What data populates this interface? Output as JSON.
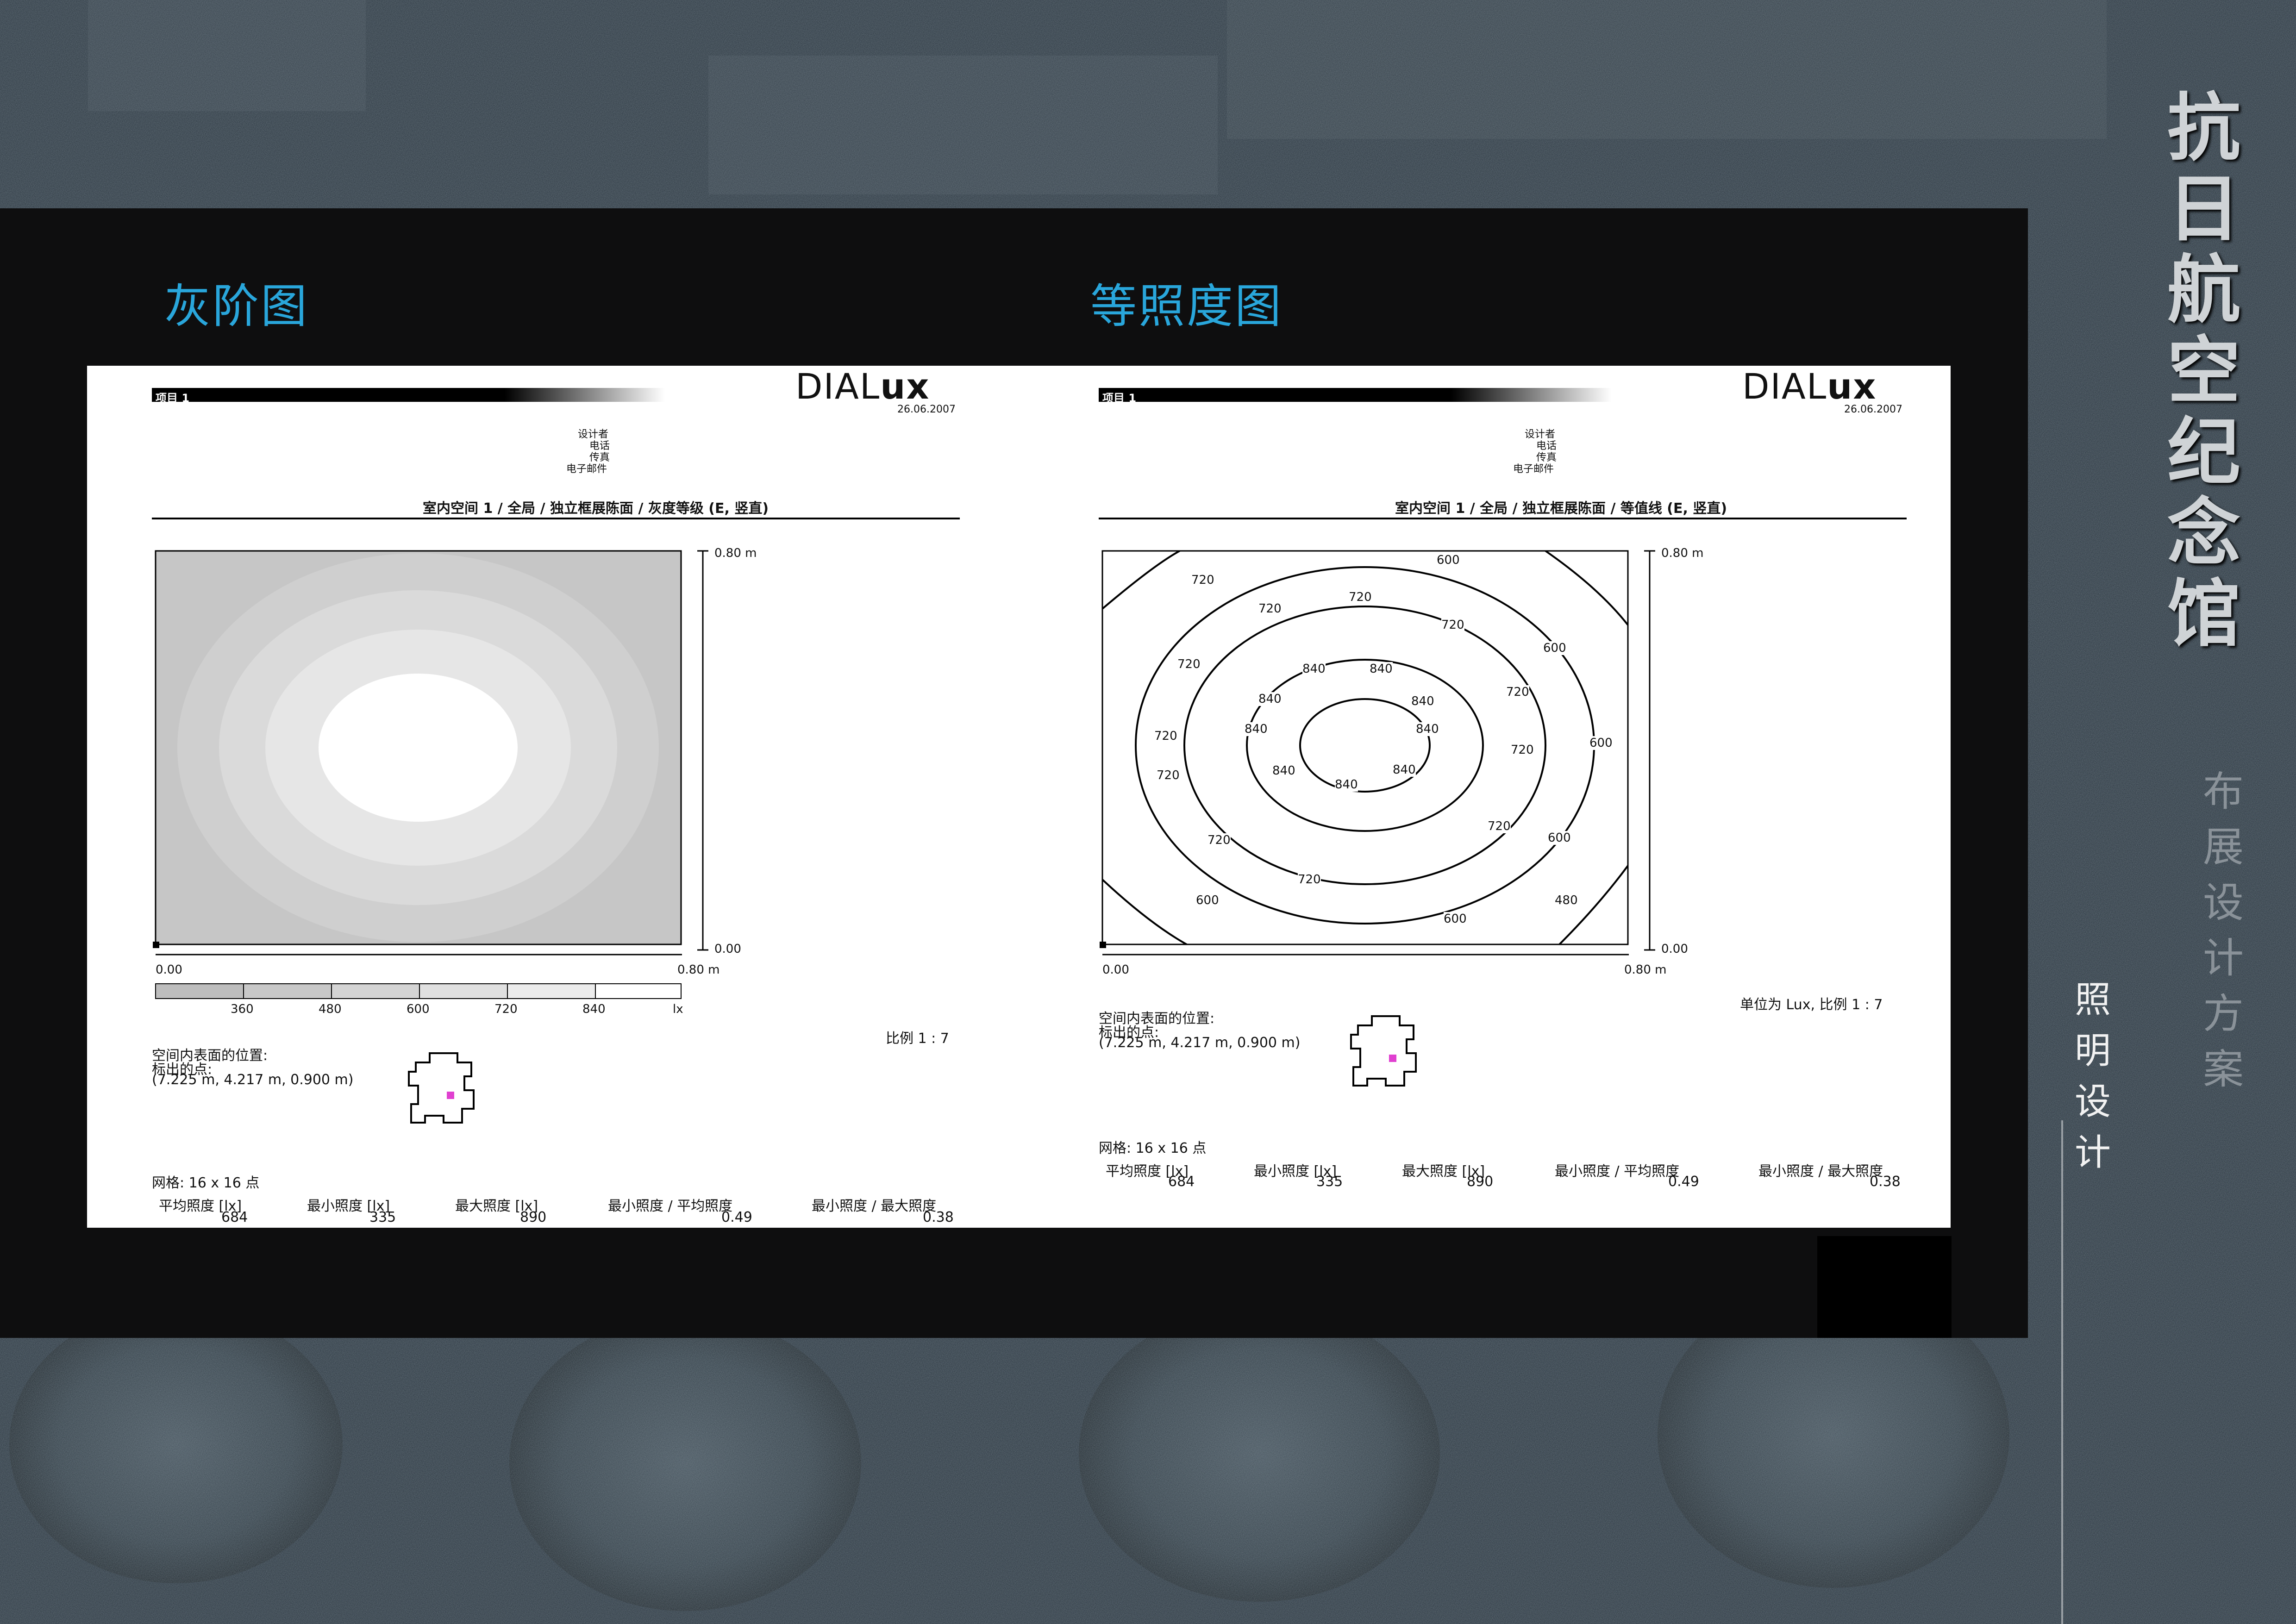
{
  "side_title": [
    "抗",
    "日",
    "航",
    "空",
    "纪",
    "念",
    "馆"
  ],
  "side_subtitle": [
    "布",
    "展",
    "设",
    "计",
    "方",
    "案"
  ],
  "section_label": [
    "照",
    "明",
    "设",
    "计"
  ],
  "sections": {
    "left_title": "灰阶图",
    "right_title": "等照度图"
  },
  "report_common": {
    "project": "项目 1",
    "logo_a": "DIAL",
    "logo_b": "ux",
    "date": "26.06.2007",
    "contact": [
      "设计者",
      "电话",
      "传真",
      "电子邮件"
    ],
    "axis_top": "0.80 m",
    "axis_zero_right": "0.00",
    "axis_zero_bottom": "0.00",
    "axis_right_bottom": "0.80 m",
    "position_label": "空间内表面的位置:",
    "marked_point": "标出的点:",
    "coords": "(7.225 m, 4.217 m, 0.900 m)",
    "grid": "网格: 16 x 16 点",
    "stats_labels": [
      "平均照度 [lx]",
      "最小照度 [lx]",
      "最大照度 [lx]",
      "最小照度 / 平均照度",
      "最小照度 / 最大照度"
    ],
    "stats_values": [
      "684",
      "335",
      "890",
      "0.49",
      "0.38"
    ]
  },
  "left_report": {
    "heading": "室内空间 1 / 全局 / 独立框展陈面 / 灰度等级 (E, 竖直)",
    "scale": "比例 1 : 7",
    "legend_values": [
      "360",
      "480",
      "600",
      "720",
      "840"
    ],
    "legend_unit": "lx",
    "legend_colors": [
      "#bdbdbd",
      "#c8c8c8",
      "#d4d4d4",
      "#e0e0e0",
      "#ececec",
      "#ffffff"
    ]
  },
  "right_report": {
    "heading": "室内空间 1 / 全局 / 独立框展陈面 / 等值线 (E, 竖直)",
    "unit_scale": "单位为 Lux, 比例 1 : 7",
    "contour_labels": [
      "600",
      "720",
      "720",
      "720",
      "600",
      "720",
      "840",
      "840",
      "840",
      "840",
      "720",
      "720",
      "840",
      "840",
      "720",
      "720",
      "840",
      "840",
      "840",
      "720",
      "600",
      "720",
      "720",
      "720",
      "600",
      "600",
      "600",
      "480"
    ]
  },
  "colors": {
    "panel": "#0e0e0f",
    "title_blue": "#29a6db",
    "marker": "#e040d0"
  }
}
